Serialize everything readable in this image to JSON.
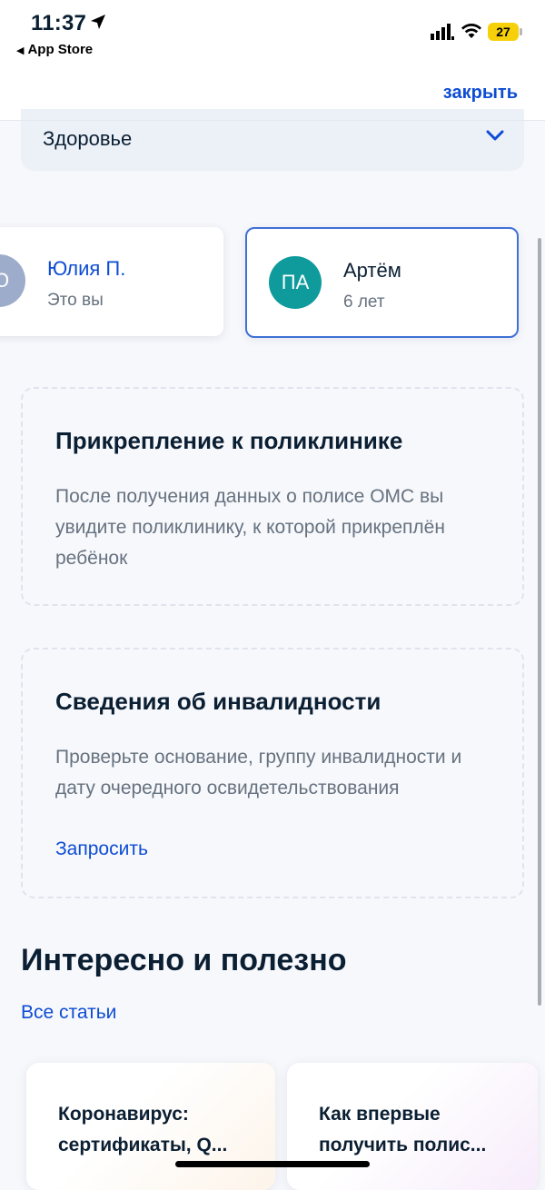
{
  "status_bar": {
    "time": "11:37",
    "back_app": "App Store",
    "battery": "27"
  },
  "header": {
    "close_label": "закрыть"
  },
  "category_select": {
    "selected": "Здоровье"
  },
  "persons": [
    {
      "initials": "Ю",
      "name": "Юлия П.",
      "subtitle": "Это вы",
      "avatar_color": "#9eaccc"
    },
    {
      "initials": "ПА",
      "name": "Артём",
      "subtitle": "6 лет",
      "avatar_color": "#0f9a9c",
      "selected": true
    }
  ],
  "cards": [
    {
      "title": "Прикрепление к поликлинике",
      "text": "После получения данных о полисе ОМС вы увидите поликлинику, к которой прикреплён ребёнок"
    },
    {
      "title": "Сведения об инвалидности",
      "text": "Проверьте основание, группу инвалидности и дату очередного освидетельствования",
      "link": "Запросить"
    }
  ],
  "section": {
    "title": "Интересно и полезно",
    "all_link": "Все статьи"
  },
  "articles": [
    {
      "title": "Коронавирус: сертификаты, Q..."
    },
    {
      "title": "Как впервые получить полис..."
    }
  ],
  "colors": {
    "accent": "#0d4cd3",
    "selected_border": "#3f70d6",
    "text_primary": "#0b1f33",
    "text_secondary": "#66727f"
  }
}
